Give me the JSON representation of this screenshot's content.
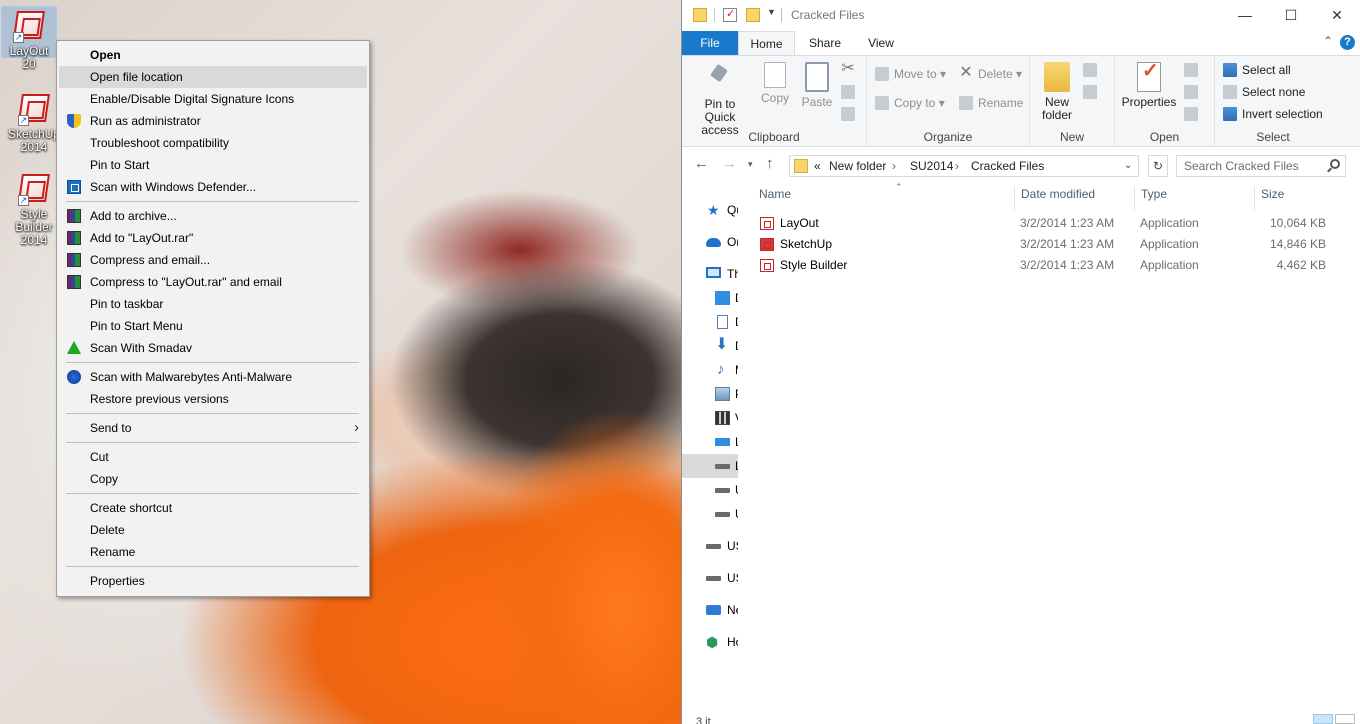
{
  "desktop": {
    "icons": [
      {
        "label": "LayOut 20"
      },
      {
        "label": "SketchUp 2014"
      },
      {
        "label": "Style Builder 2014"
      }
    ]
  },
  "context_menu": {
    "items": [
      {
        "label": "Open"
      },
      {
        "label": "Open file location"
      },
      {
        "label": "Enable/Disable Digital Signature Icons"
      },
      {
        "label": "Run as administrator"
      },
      {
        "label": "Troubleshoot compatibility"
      },
      {
        "label": "Pin to Start"
      },
      {
        "label": "Scan with Windows Defender..."
      },
      {
        "label": "Add to archive..."
      },
      {
        "label": "Add to \"LayOut.rar\""
      },
      {
        "label": "Compress and email..."
      },
      {
        "label": "Compress to \"LayOut.rar\" and email"
      },
      {
        "label": "Pin to taskbar"
      },
      {
        "label": "Pin to Start Menu"
      },
      {
        "label": "Scan With Smadav"
      },
      {
        "label": "Scan with Malwarebytes Anti-Malware"
      },
      {
        "label": "Restore previous versions"
      },
      {
        "label": "Send to"
      },
      {
        "label": "Cut"
      },
      {
        "label": "Copy"
      },
      {
        "label": "Create shortcut"
      },
      {
        "label": "Delete"
      },
      {
        "label": "Rename"
      },
      {
        "label": "Properties"
      }
    ]
  },
  "explorer": {
    "title": "Cracked Files",
    "window_controls": {
      "minimize": "—",
      "maximize": "☐",
      "close": "✕"
    },
    "tabs": [
      "File",
      "Home",
      "Share",
      "View"
    ],
    "ribbon": {
      "clipboard": {
        "label": "Clipboard",
        "pin_quick_access": "Pin to Quick access",
        "copy": "Copy",
        "paste": "Paste"
      },
      "organize": {
        "label": "Organize",
        "move_to": "Move to",
        "copy_to": "Copy to",
        "delete": "Delete",
        "rename": "Rename"
      },
      "new": {
        "label": "New",
        "new_folder": "New folder"
      },
      "open": {
        "label": "Open",
        "properties": "Properties"
      },
      "select": {
        "label": "Select",
        "select_all": "Select all",
        "select_none": "Select none",
        "invert_selection": "Invert selection"
      }
    },
    "address": {
      "overflow": "«",
      "crumbs": [
        "New folder",
        "SU2014",
        "Cracked Files"
      ],
      "search_placeholder": "Search Cracked Files"
    },
    "nav_pane": [
      {
        "label": "Qu",
        "icon": "star-icon"
      },
      {
        "label": "Or",
        "icon": "onedrive-icon"
      },
      {
        "label": "Th",
        "icon": "this-pc-icon"
      },
      {
        "label": "D",
        "icon": "desktop-icon"
      },
      {
        "label": "D",
        "icon": "documents-icon"
      },
      {
        "label": "D",
        "icon": "downloads-icon"
      },
      {
        "label": "M",
        "icon": "music-icon"
      },
      {
        "label": "P",
        "icon": "pictures-icon"
      },
      {
        "label": "V",
        "icon": "videos-icon"
      },
      {
        "label": "L",
        "icon": "local-disk-icon"
      },
      {
        "label": "L",
        "icon": "drive-icon"
      },
      {
        "label": "U",
        "icon": "drive-icon"
      },
      {
        "label": "U",
        "icon": "drive-icon"
      },
      {
        "label": "US",
        "icon": "usb-icon"
      },
      {
        "label": "US",
        "icon": "usb-icon"
      },
      {
        "label": "Ne",
        "icon": "network-icon"
      },
      {
        "label": "Ho",
        "icon": "homegroup-icon"
      }
    ],
    "columns": [
      "Name",
      "Date modified",
      "Type",
      "Size"
    ],
    "files": [
      {
        "name": "LayOut",
        "date": "3/2/2014 1:23 AM",
        "type": "Application",
        "size": "10,064 KB"
      },
      {
        "name": "SketchUp",
        "date": "3/2/2014 1:23 AM",
        "type": "Application",
        "size": "14,846 KB"
      },
      {
        "name": "Style Builder",
        "date": "3/2/2014 1:23 AM",
        "type": "Application",
        "size": "4,462 KB"
      }
    ],
    "status": "3 it"
  }
}
